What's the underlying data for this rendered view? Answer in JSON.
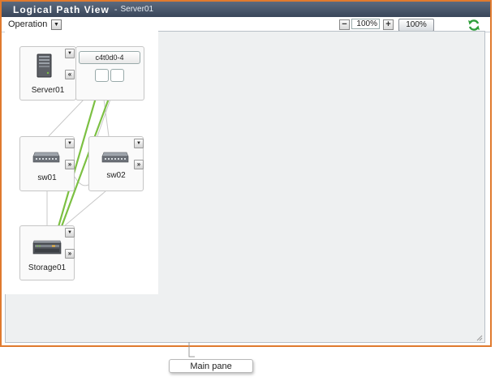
{
  "window": {
    "title": "Logical Path View",
    "title_separator": "-",
    "subtitle": "Server01"
  },
  "toolbar": {
    "operation_label": "Operation",
    "zoom_value": "100%",
    "zoom_reset_label": "100%"
  },
  "nodes": {
    "server": {
      "label": "Server01",
      "path_label": "c4t0d0-4"
    },
    "switch1": {
      "label": "sw01"
    },
    "switch2": {
      "label": "sw02"
    },
    "storage": {
      "label": "Storage01"
    }
  },
  "icons": {
    "dropdown": "chevron-down-icon",
    "expand": "double-chevron-right-icon",
    "collapse": "double-chevron-left-icon",
    "zoom_out": "minus-icon",
    "zoom_in": "plus-icon",
    "refresh": "refresh-icon"
  },
  "colors": {
    "window_border": "#e07a2e",
    "titlebar": "#39465a",
    "active_path": "#7cc043",
    "inactive_path": "#c8c8c8",
    "refresh_icon": "#2e9e3a"
  },
  "callout": {
    "label": "Main pane"
  }
}
